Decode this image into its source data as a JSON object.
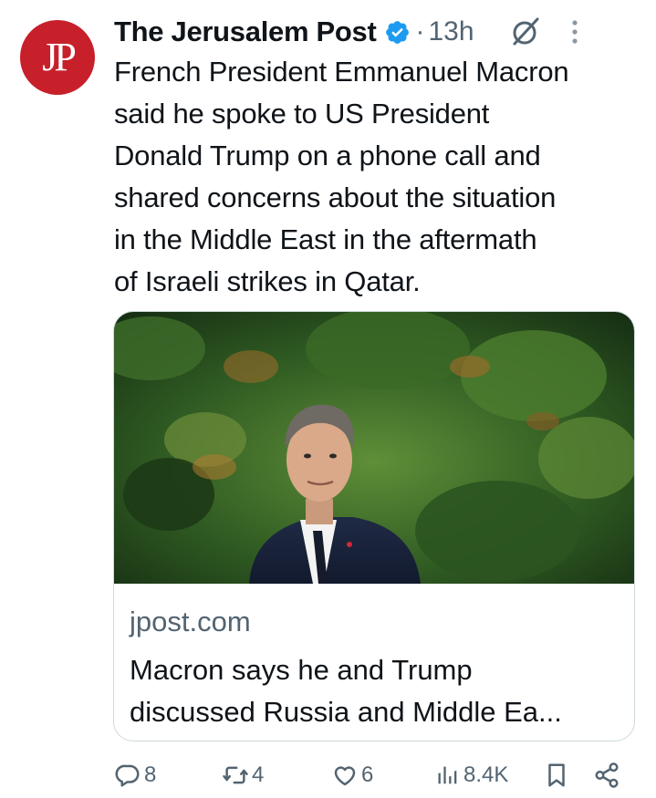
{
  "author": {
    "name": "The Jerusalem Post",
    "avatar_text": "JP",
    "verified": true
  },
  "meta": {
    "separator": "·",
    "timestamp": "13h"
  },
  "tweet": {
    "lines": [
      "French President Emmanuel Macron",
      "said he spoke to US President",
      "Donald Trump on a phone call and",
      "shared concerns about the situation",
      "in the Middle East in the aftermath",
      "of Israeli strikes in Qatar."
    ]
  },
  "card": {
    "domain": "jpost.com",
    "title_lines": [
      "Macron says he and Trump",
      "discussed Russia and Middle Ea..."
    ]
  },
  "actions": {
    "replies": "8",
    "reposts": "4",
    "likes": "6",
    "views": "8.4K"
  },
  "icons": {
    "verified": "verified-badge-icon",
    "grok": "grok-icon",
    "more": "more-options-icon",
    "reply": "reply-icon",
    "repost": "repost-icon",
    "like": "heart-icon",
    "views": "views-chart-icon",
    "bookmark": "bookmark-icon",
    "share": "share-icon"
  },
  "colors": {
    "brand_red": "#c7202b",
    "verified_blue": "#1d9bf0",
    "secondary_text": "#536471",
    "primary_text": "#0f1419",
    "card_border": "#cfd9de"
  }
}
